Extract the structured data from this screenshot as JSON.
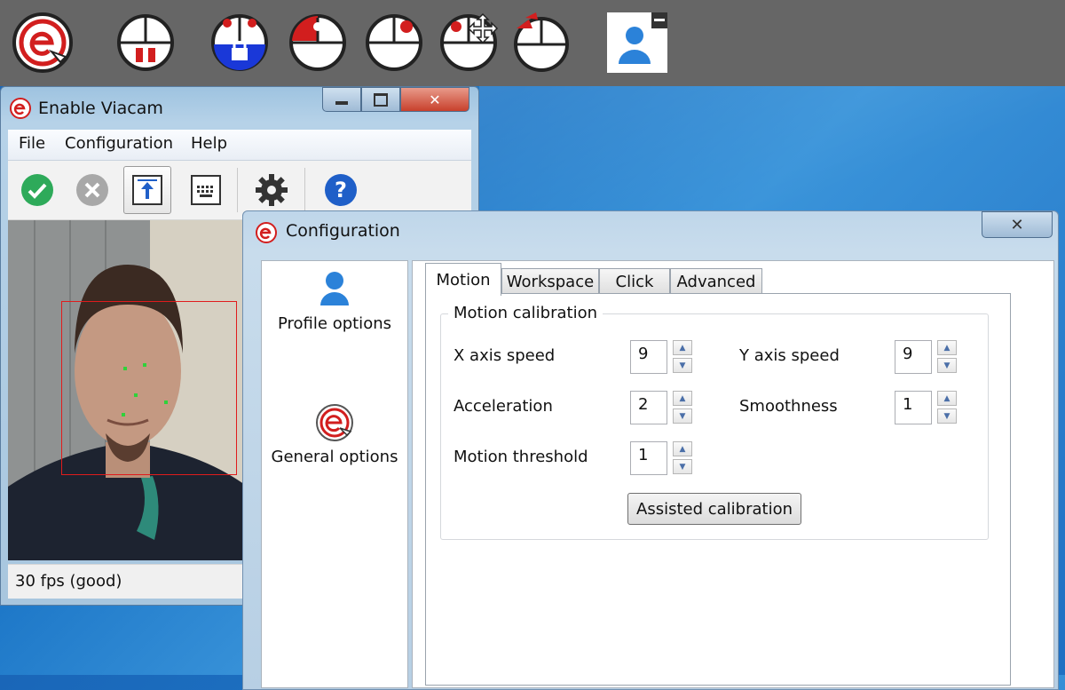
{
  "colors": {
    "toolbar_bg": "#666666",
    "accent_red": "#d21e1e",
    "lock_blue": "#1a38d8",
    "help_blue": "#1f5fc8",
    "ok_green": "#2eaa5a"
  },
  "topbar": {
    "items": [
      {
        "icon": "enable-viacam-logo-icon"
      },
      {
        "icon": "pause-icon"
      },
      {
        "icon": "lock-icon"
      },
      {
        "icon": "left-click-icon"
      },
      {
        "icon": "right-click-icon"
      },
      {
        "icon": "drag-icon"
      },
      {
        "icon": "double-click-icon"
      },
      {
        "icon": "profile-icon"
      }
    ]
  },
  "viacam_window": {
    "title": "Enable Viacam",
    "menu": [
      "File",
      "Configuration",
      "Help"
    ],
    "toolbar": [
      {
        "icon": "check-icon"
      },
      {
        "icon": "cancel-icon"
      },
      {
        "icon": "align-top-icon"
      },
      {
        "icon": "keyboard-icon"
      },
      {
        "icon": "gear-icon"
      },
      {
        "icon": "help-icon"
      }
    ],
    "status": "30 fps (good)"
  },
  "config_dialog": {
    "title": "Configuration",
    "close_symbol": "✕",
    "sidebar": [
      {
        "label": "Profile options",
        "icon": "user-icon"
      },
      {
        "label": "General options",
        "icon": "enable-viacam-logo-icon"
      }
    ],
    "tabs": [
      "Motion",
      "Workspace",
      "Click",
      "Advanced"
    ],
    "group_title": "Motion calibration",
    "fields": {
      "x_axis_speed": {
        "label": "X axis speed",
        "value": "9"
      },
      "y_axis_speed": {
        "label": "Y axis speed",
        "value": "9"
      },
      "acceleration": {
        "label": "Acceleration",
        "value": "2"
      },
      "smoothness": {
        "label": "Smoothness",
        "value": "1"
      },
      "motion_threshold": {
        "label": "Motion threshold",
        "value": "1"
      }
    },
    "assisted_button": "Assisted calibration"
  }
}
